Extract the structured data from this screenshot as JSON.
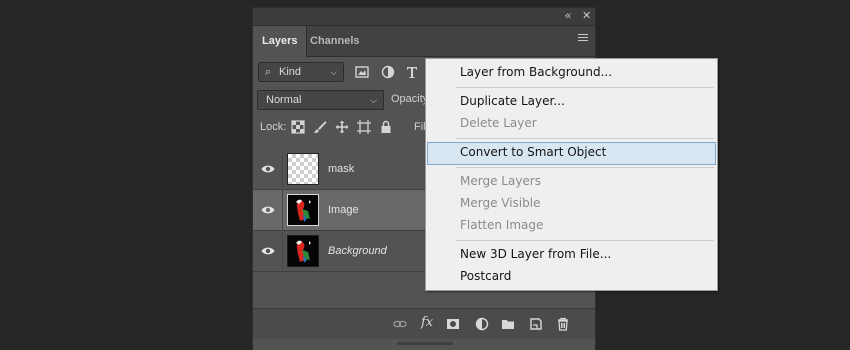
{
  "layers_panel": {
    "tabs": [
      {
        "label": "Layers",
        "active": true
      },
      {
        "label": "Channels",
        "active": false
      }
    ],
    "collapse_icon": "double-chevron-left-icon",
    "close_icon": "close-icon",
    "filter": {
      "label": "Kind",
      "icon": "magnifier-icon",
      "filter_icons": [
        "image-filter-icon",
        "adjustment-filter-icon",
        "type-filter-icon"
      ]
    },
    "blend_mode": "Normal",
    "opacity_label": "Opacity",
    "lock_label": "Lock:",
    "lock_icons": [
      "lock-transparent-pixels-icon",
      "lock-image-pixels-icon",
      "lock-position-icon",
      "prevent-autonest-icon"
    ],
    "fill_label": "Fill",
    "layers": [
      {
        "name": "mask",
        "visible": true,
        "selected": false,
        "thumbnail": "transparent"
      },
      {
        "name": "Image",
        "visible": true,
        "selected": true,
        "thumbnail": "parrot"
      },
      {
        "name": "Background",
        "visible": true,
        "selected": false,
        "thumbnail": "parrot"
      }
    ],
    "bottom_icons": [
      "link-icon",
      "fx-icon",
      "add-mask-icon",
      "adjustment-layer-icon",
      "group-folder-icon",
      "new-layer-icon",
      "trash-icon"
    ],
    "bottom_fx_label": "fx"
  },
  "context_menu": {
    "items": [
      {
        "label": "Layer from Background...",
        "enabled": true
      },
      {
        "separator": true
      },
      {
        "label": "Duplicate Layer...",
        "enabled": true
      },
      {
        "label": "Delete Layer",
        "enabled": false
      },
      {
        "separator": true
      },
      {
        "label": "Convert to Smart Object",
        "enabled": true,
        "highlighted": true
      },
      {
        "separator": true
      },
      {
        "label": "Merge Layers",
        "enabled": false
      },
      {
        "label": "Merge Visible",
        "enabled": false
      },
      {
        "label": "Flatten Image",
        "enabled": false
      },
      {
        "separator": true
      },
      {
        "label": "New 3D Layer from File...",
        "enabled": true
      },
      {
        "label": "Postcard",
        "enabled": true
      }
    ]
  },
  "colors": {
    "background": "#262626",
    "panel": "#535353",
    "selected_row": "#696969",
    "menu_bg": "#efefef",
    "menu_highlight": "#d8e6f2"
  }
}
